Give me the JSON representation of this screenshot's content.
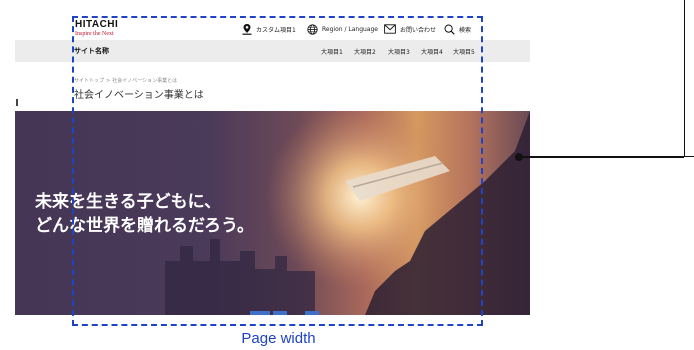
{
  "header": {
    "logo_text": "HITACHI",
    "tagline": "Inspire the Next",
    "util": {
      "custom": "カスタム項目1",
      "region": "Region / Language",
      "contact": "お問い合わせ",
      "search": "検索"
    }
  },
  "nav": {
    "site_name": "サイト名称",
    "items": [
      "大項目1",
      "大項目2",
      "大項目3",
      "大項目4",
      "大項目5"
    ]
  },
  "breadcrumb": {
    "top": "サイトトップ",
    "sep": ">",
    "current": "社会イノベーション事業とは"
  },
  "page_title": "社会イノベーション事業とは",
  "hero": {
    "line1": "未来を生きる子どもに、",
    "line2": "どんな世界を贈れるだろう。"
  },
  "annotation": {
    "label": "Page width"
  },
  "colors": {
    "accent_red": "#c0142e",
    "guide_blue": "#1e43c8",
    "hero_purple": "#453656",
    "nav_gray": "#ececec"
  }
}
